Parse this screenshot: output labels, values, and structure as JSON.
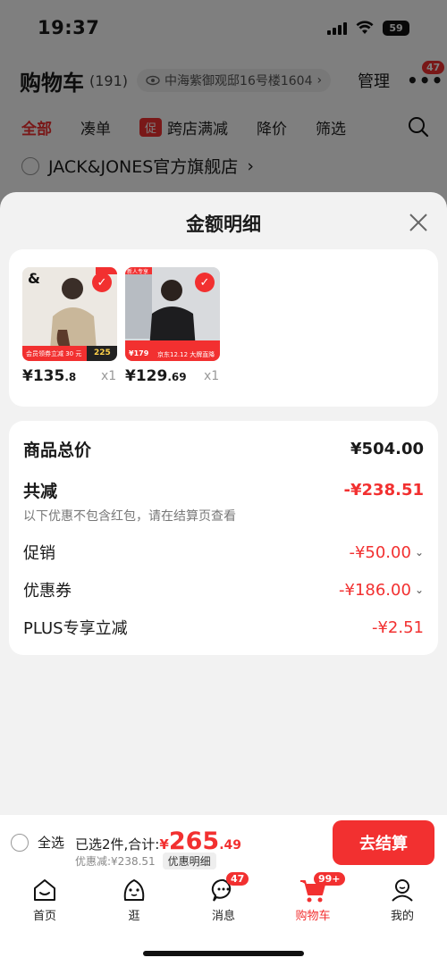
{
  "status": {
    "time": "19:37",
    "battery": "59"
  },
  "header": {
    "title": "购物车",
    "count": "(191)",
    "address": "中海紫御观邸16号楼1604",
    "manage": "管理",
    "more": "•••",
    "badge": "47"
  },
  "tabs": [
    {
      "label": "全部"
    },
    {
      "label": "凑单"
    },
    {
      "label": "跨店满减",
      "tag": "促"
    },
    {
      "label": "降价"
    },
    {
      "label": "筛选"
    }
  ],
  "store": {
    "name": "JACK&JONES官方旗舰店",
    "chevron": "›"
  },
  "sheet": {
    "title": "金额明细",
    "products": [
      {
        "price_int": "¥135",
        "price_dec": ".8",
        "qty": "x1",
        "banner_text": "会员领券立减 30 元",
        "badge": "225"
      },
      {
        "price_int": "¥129",
        "price_dec": ".69",
        "qty": "x1",
        "banner_price": "¥179",
        "banner_text": "京东12.12 大牌直降",
        "top_tag": "新人专享"
      }
    ],
    "summary": {
      "total_label": "商品总价",
      "total_value": "¥504.00",
      "discount_label": "共减",
      "discount_value": "-¥238.51",
      "note": "以下优惠不包含红包，请在结算页查看",
      "promo_label": "促销",
      "promo_value": "-¥50.00",
      "coupon_label": "优惠券",
      "coupon_value": "-¥186.00",
      "plus_label": "PLUS专享立减",
      "plus_value": "-¥2.51"
    }
  },
  "bottom": {
    "select_all": "全选",
    "selected_text": "已选2件,合计:",
    "yen": "¥",
    "sum_int": "265",
    "sum_dec": ".49",
    "discount_text": "优惠减:¥238.51",
    "detail_label": "优惠明细",
    "checkout": "去结算"
  },
  "tabbar": [
    {
      "label": "首页",
      "icon": "home-icon"
    },
    {
      "label": "逛",
      "icon": "stroll-icon"
    },
    {
      "label": "消息",
      "icon": "message-icon",
      "badge": "47"
    },
    {
      "label": "购物车",
      "icon": "cart-icon",
      "badge": "99+"
    },
    {
      "label": "我的",
      "icon": "profile-icon"
    }
  ],
  "colors": {
    "accent": "#f23030"
  }
}
